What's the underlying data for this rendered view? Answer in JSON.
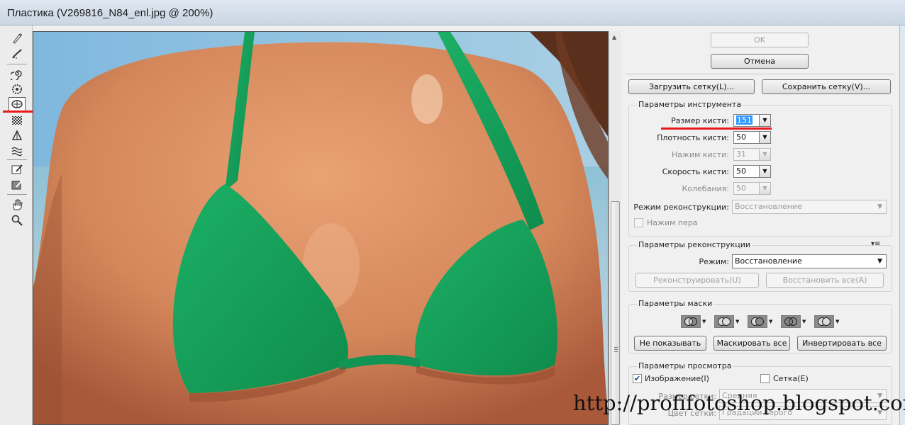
{
  "window": {
    "title": "Пластика (V269816_N84_enl.jpg @ 200%)"
  },
  "toolbar": {
    "tools": [
      "forward-warp-icon",
      "reconstruct-icon",
      "twirl-icon",
      "pucker-icon",
      "bloat-icon",
      "push-left-icon",
      "mirror-icon",
      "turbulence-icon",
      "freeze-mask-icon",
      "thaw-mask-icon",
      "hand-icon",
      "zoom-icon"
    ],
    "active_tool": "bloat-icon"
  },
  "actions": {
    "ok_label": "OK",
    "cancel_label": "Отмена"
  },
  "mesh": {
    "load_label": "Загрузить сетку(L)...",
    "save_label": "Сохранить сетку(V)..."
  },
  "tool_options": {
    "title": "Параметры инструмента",
    "brush_size_label": "Размер кисти:",
    "brush_size_value": "151",
    "brush_density_label": "Плотность кисти:",
    "brush_density_value": "50",
    "brush_pressure_label": "Нажим кисти:",
    "brush_pressure_value": "31",
    "brush_rate_label": "Скорость кисти:",
    "brush_rate_value": "50",
    "turbulent_jitter_label": "Колебания:",
    "turbulent_jitter_value": "50",
    "reconstruct_mode_label": "Режим реконструкции:",
    "reconstruct_mode_value": "Восстановление",
    "stylus_pressure_label": "Нажим пера"
  },
  "reconstruct_options": {
    "title": "Параметры реконструкции",
    "mode_label": "Режим:",
    "mode_value": "Восстановление",
    "reconstruct_label": "Реконструировать(U)",
    "restore_all_label": "Восстановить все(A)"
  },
  "mask_options": {
    "title": "Параметры маски",
    "none_label": "Не показывать",
    "mask_all_label": "Маскировать все",
    "invert_all_label": "Инвертировать все"
  },
  "view_options": {
    "title": "Параметры просмотра",
    "show_image_label": "Изображение(I)",
    "show_image_checked": true,
    "show_mesh_label": "Сетка(E)",
    "show_mesh_checked": false,
    "mesh_size_label": "Размер сетки:",
    "mesh_size_value": "Средняя",
    "mesh_color_label": "Цвет сетки:",
    "mesh_color_value": "Градации серого"
  },
  "watermark": "http://profifotoshop.blogspot.com",
  "colors": {
    "bikini": "#16a15a",
    "skin": "#d98a5e",
    "highlight_mark": "#e8191b"
  }
}
